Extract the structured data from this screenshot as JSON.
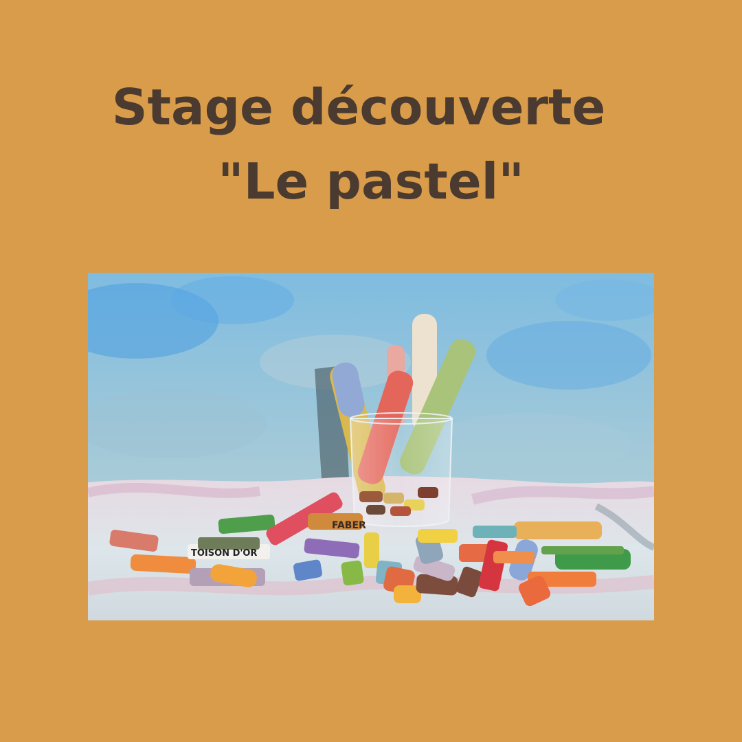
{
  "poster": {
    "title_line1": "Stage découverte",
    "title_line2": "\"Le pastel\"",
    "photo": {
      "printed_labels": [
        "FABER",
        "TOISON D'OR"
      ]
    }
  },
  "colors": {
    "background": "#D89C4A",
    "title_text": "#4A3A2F",
    "sky": "#8EC6E2",
    "cloth": "#DCE3E6"
  }
}
